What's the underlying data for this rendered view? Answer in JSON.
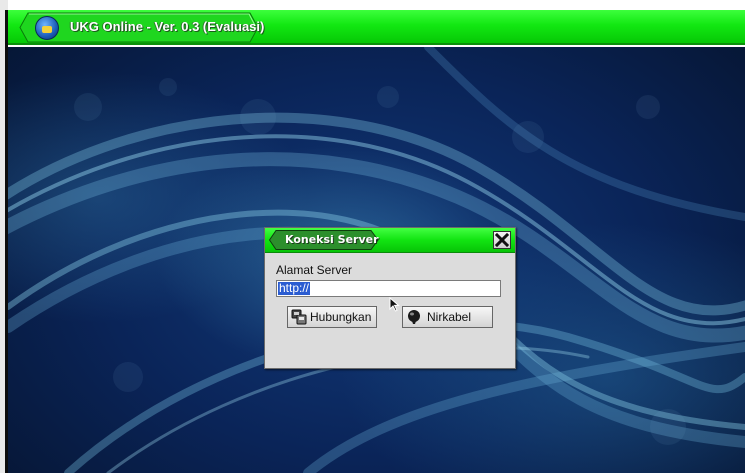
{
  "app": {
    "title": "UKG Online - Ver. 0.3 (Evaluasi)",
    "logo_icon": "education-logo-icon",
    "titlebar_color": "#12e812"
  },
  "dialog": {
    "title": "Koneksi Server",
    "close_icon": "close-icon",
    "field_label": "Alamat Server",
    "server_url": "http://",
    "buttons": {
      "connect_label": "Hubungkan",
      "connect_icon": "connect-icon",
      "wireless_label": "Nirkabel",
      "wireless_icon": "wireless-icon"
    }
  },
  "colors": {
    "accent_green": "#12e812",
    "selection_blue": "#2b5cd1",
    "desktop_blue": "#0a2458"
  }
}
